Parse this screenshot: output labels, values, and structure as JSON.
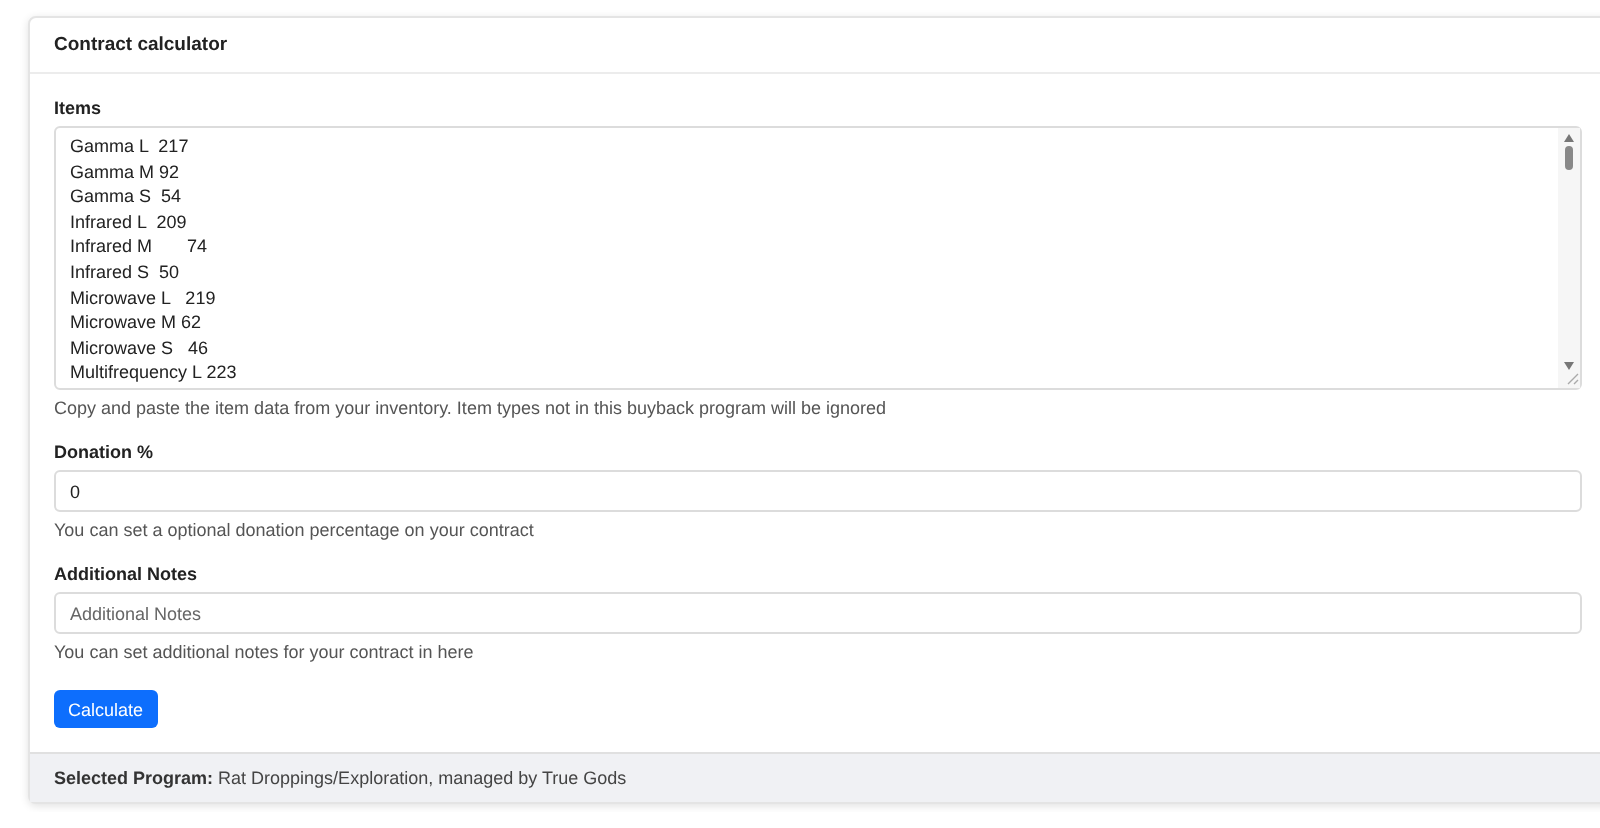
{
  "card": {
    "title": "Contract calculator"
  },
  "items": {
    "label": "Items",
    "lines": [
      "Gamma L  217",
      "Gamma M 92",
      "Gamma S  54",
      "Infrared L  209",
      "Infrared M       74",
      "Infrared S  50",
      "Microwave L   219",
      "Microwave M 62",
      "Microwave S   46",
      "Multifrequency L 223"
    ],
    "help": "Copy and paste the item data from your inventory. Item types not in this buyback program will be ignored"
  },
  "donation": {
    "label": "Donation %",
    "value": "0",
    "help": "You can set a optional donation percentage on your contract"
  },
  "notes": {
    "label": "Additional Notes",
    "placeholder": "Additional Notes",
    "help": "You can set additional notes for your contract in here"
  },
  "button": "Calculate",
  "footer": {
    "label": "Selected Program:",
    "text": "Rat Droppings/Exploration, managed by True Gods"
  }
}
